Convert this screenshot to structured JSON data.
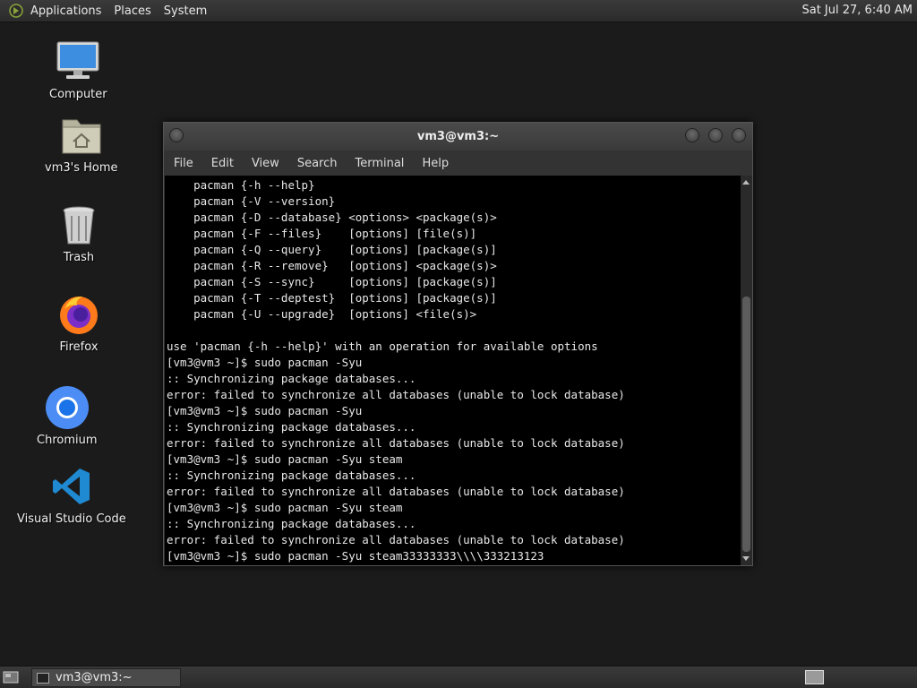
{
  "top_panel": {
    "menus": [
      "Applications",
      "Places",
      "System"
    ],
    "clock": "Sat Jul 27,  6:40 AM"
  },
  "desktop_icons": [
    {
      "label": "Computer",
      "icon": "computer-icon"
    },
    {
      "label": "vm3's Home",
      "icon": "home-folder-icon"
    },
    {
      "label": "Trash",
      "icon": "trash-icon"
    },
    {
      "label": "Firefox",
      "icon": "firefox-icon"
    },
    {
      "label": "Chromium",
      "icon": "chromium-icon"
    },
    {
      "label": "Visual Studio Code",
      "icon": "vscode-icon"
    }
  ],
  "terminal": {
    "title": "vm3@vm3:~",
    "menu": [
      "File",
      "Edit",
      "View",
      "Search",
      "Terminal",
      "Help"
    ],
    "lines": [
      "    pacman {-h --help}",
      "    pacman {-V --version}",
      "    pacman {-D --database} <options> <package(s)>",
      "    pacman {-F --files}    [options] [file(s)]",
      "    pacman {-Q --query}    [options] [package(s)]",
      "    pacman {-R --remove}   [options] <package(s)>",
      "    pacman {-S --sync}     [options] [package(s)]",
      "    pacman {-T --deptest}  [options] [package(s)]",
      "    pacman {-U --upgrade}  [options] <file(s)>",
      "",
      "use 'pacman {-h --help}' with an operation for available options",
      "[vm3@vm3 ~]$ sudo pacman -Syu",
      ":: Synchronizing package databases...",
      "error: failed to synchronize all databases (unable to lock database)",
      "[vm3@vm3 ~]$ sudo pacman -Syu",
      ":: Synchronizing package databases...",
      "error: failed to synchronize all databases (unable to lock database)",
      "[vm3@vm3 ~]$ sudo pacman -Syu steam",
      ":: Synchronizing package databases...",
      "error: failed to synchronize all databases (unable to lock database)",
      "[vm3@vm3 ~]$ sudo pacman -Syu steam",
      ":: Synchronizing package databases...",
      "error: failed to synchronize all databases (unable to lock database)",
      "[vm3@vm3 ~]$ sudo pacman -Syu steam33333333\\\\\\\\333213123"
    ]
  },
  "taskbar": {
    "window_button": "vm3@vm3:~"
  }
}
